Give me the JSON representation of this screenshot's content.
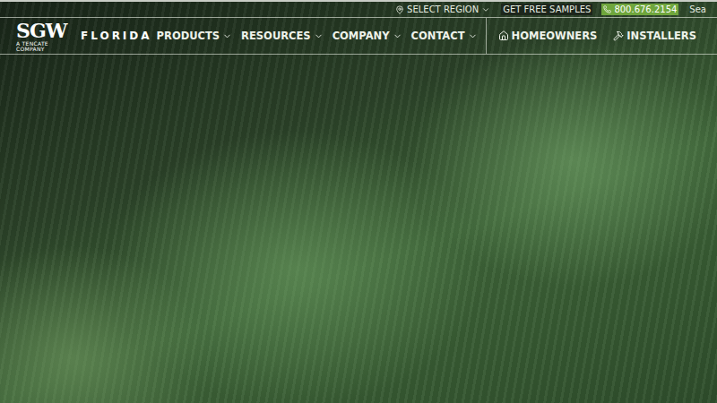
{
  "header": {
    "utility": {
      "region": {
        "label": "SELECT REGION",
        "hasMenu": true
      },
      "samples": {
        "label": "GET FREE SAMPLES"
      },
      "phone": {
        "label": "800.676.2154"
      },
      "search": {
        "label": "Sea"
      }
    },
    "logo": {
      "mark": "SGW",
      "tagline": "A TENCATE COMPANY",
      "region": "FLORIDA"
    },
    "nav": [
      {
        "label": "PRODUCTS",
        "hasMenu": true
      },
      {
        "label": "RESOURCES",
        "hasMenu": true
      },
      {
        "label": "COMPANY",
        "hasMenu": true
      },
      {
        "label": "CONTACT",
        "hasMenu": true
      }
    ],
    "audience": [
      {
        "label": "HOMEOWNERS",
        "kind": "home"
      },
      {
        "label": "INSTALLERS",
        "kind": "tools"
      }
    ]
  }
}
